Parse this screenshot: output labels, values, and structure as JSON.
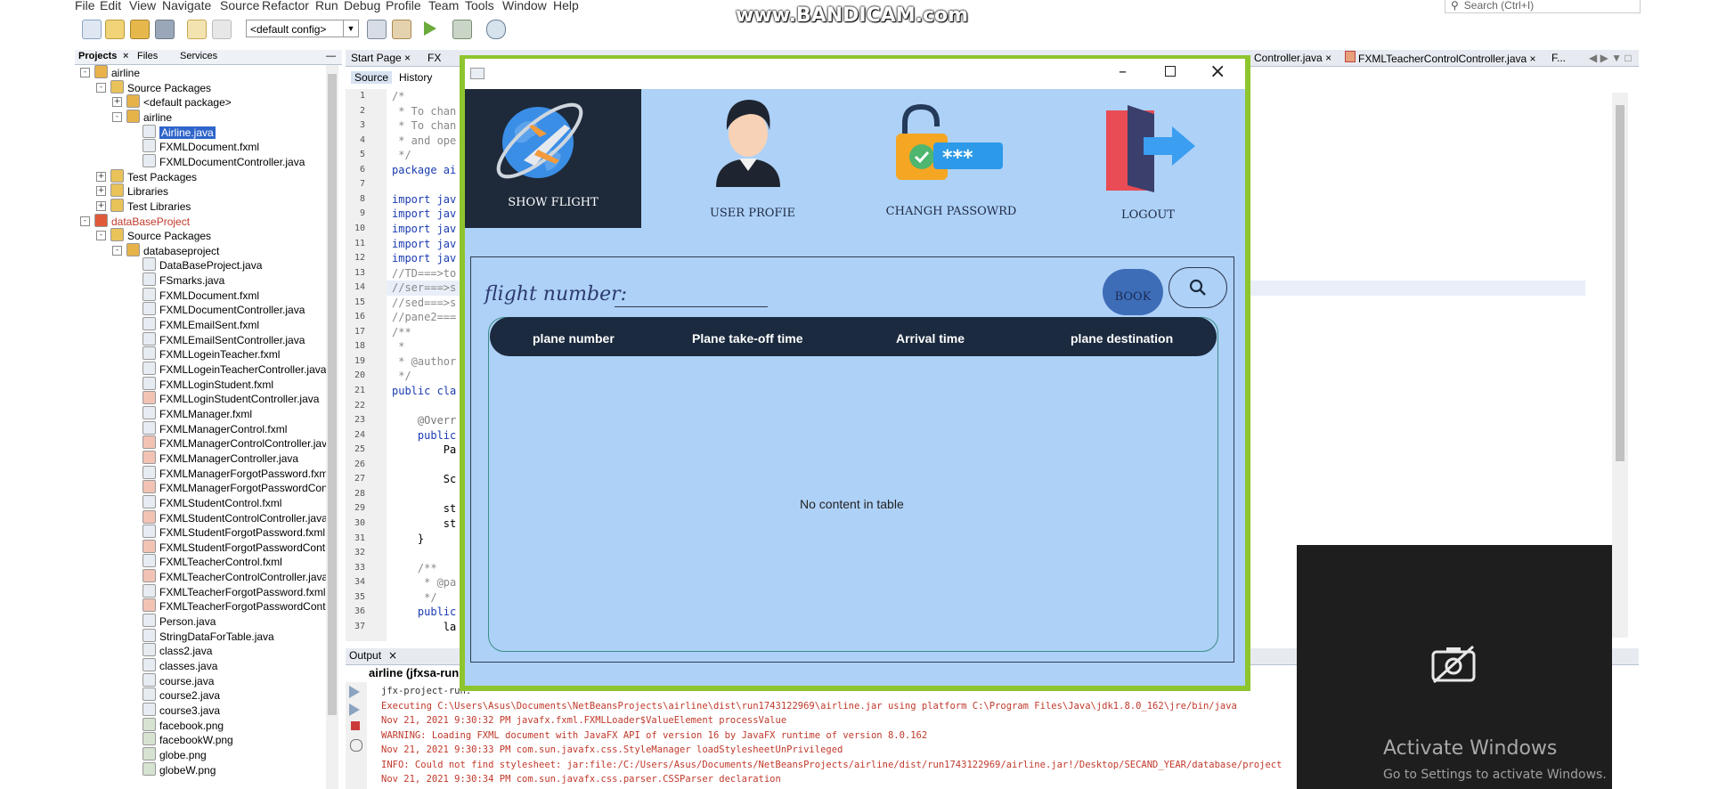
{
  "ide": {
    "menu": [
      "File",
      "Edit",
      "View",
      "Navigate",
      "Source",
      "Refactor",
      "Run",
      "Debug",
      "Profile",
      "Team",
      "Tools",
      "Window",
      "Help"
    ],
    "search_placeholder": "Search (Ctrl+I)",
    "config": "<default config>",
    "panel_tabs": [
      "Projects",
      "Files",
      "Services"
    ],
    "editor_tabs": [
      "Start Page",
      "FX",
      "Controller.java",
      "FXMLTeacherControlController.java",
      "F..."
    ],
    "source_tabs": [
      "Source",
      "History"
    ],
    "tree": [
      {
        "label": "airline",
        "level": 0,
        "toggle": "-",
        "icon": "project-icon",
        "color": "#000"
      },
      {
        "label": "Source Packages",
        "level": 1,
        "toggle": "-",
        "icon": "folder-icon",
        "color": "#000"
      },
      {
        "label": "<default package>",
        "level": 2,
        "toggle": "+",
        "icon": "package-icon",
        "color": "#000"
      },
      {
        "label": "airline",
        "level": 2,
        "toggle": "-",
        "icon": "package-icon",
        "color": "#000"
      },
      {
        "label": "Airline.java",
        "level": 3,
        "toggle": "",
        "icon": "java-file-icon",
        "color": "#fff",
        "selected": true
      },
      {
        "label": "FXMLDocument.fxml",
        "level": 3,
        "toggle": "",
        "icon": "fxml-file-icon",
        "color": "#000"
      },
      {
        "label": "FXMLDocumentController.java",
        "level": 3,
        "toggle": "",
        "icon": "java-file-icon",
        "color": "#000"
      },
      {
        "label": "Test Packages",
        "level": 1,
        "toggle": "+",
        "icon": "folder-icon",
        "color": "#000"
      },
      {
        "label": "Libraries",
        "level": 1,
        "toggle": "+",
        "icon": "folder-icon",
        "color": "#000"
      },
      {
        "label": "Test Libraries",
        "level": 1,
        "toggle": "+",
        "icon": "folder-icon",
        "color": "#000"
      },
      {
        "label": "dataBaseProject",
        "level": 0,
        "toggle": "-",
        "icon": "project-error-icon",
        "color": "#c0392b"
      },
      {
        "label": "Source Packages",
        "level": 1,
        "toggle": "-",
        "icon": "folder-icon",
        "color": "#000"
      },
      {
        "label": "databaseproject",
        "level": 2,
        "toggle": "-",
        "icon": "package-icon",
        "color": "#000"
      },
      {
        "label": "DataBaseProject.java",
        "level": 3,
        "toggle": "",
        "icon": "java-file-icon",
        "color": "#000"
      },
      {
        "label": "FSmarks.java",
        "level": 3,
        "toggle": "",
        "icon": "java-file-icon",
        "color": "#000"
      },
      {
        "label": "FXMLDocument.fxml",
        "level": 3,
        "toggle": "",
        "icon": "fxml-file-icon",
        "color": "#000"
      },
      {
        "label": "FXMLDocumentController.java",
        "level": 3,
        "toggle": "",
        "icon": "java-file-icon",
        "color": "#000"
      },
      {
        "label": "FXMLEmailSent.fxml",
        "level": 3,
        "toggle": "",
        "icon": "fxml-file-icon",
        "color": "#000"
      },
      {
        "label": "FXMLEmailSentController.java",
        "level": 3,
        "toggle": "",
        "icon": "java-file-icon",
        "color": "#000"
      },
      {
        "label": "FXMLLogeinTeacher.fxml",
        "level": 3,
        "toggle": "",
        "icon": "fxml-file-icon",
        "color": "#000"
      },
      {
        "label": "FXMLLogeinTeacherController.java",
        "level": 3,
        "toggle": "",
        "icon": "java-file-icon",
        "color": "#000"
      },
      {
        "label": "FXMLLoginStudent.fxml",
        "level": 3,
        "toggle": "",
        "icon": "fxml-file-icon",
        "color": "#000"
      },
      {
        "label": "FXMLLoginStudentController.java",
        "level": 3,
        "toggle": "",
        "icon": "java-error-icon",
        "color": "#000"
      },
      {
        "label": "FXMLManager.fxml",
        "level": 3,
        "toggle": "",
        "icon": "fxml-file-icon",
        "color": "#000"
      },
      {
        "label": "FXMLManagerControl.fxml",
        "level": 3,
        "toggle": "",
        "icon": "fxml-file-icon",
        "color": "#000"
      },
      {
        "label": "FXMLManagerControlController.java",
        "level": 3,
        "toggle": "",
        "icon": "java-error-icon",
        "color": "#000"
      },
      {
        "label": "FXMLManagerController.java",
        "level": 3,
        "toggle": "",
        "icon": "java-error-icon",
        "color": "#000"
      },
      {
        "label": "FXMLManagerForgotPassword.fxml",
        "level": 3,
        "toggle": "",
        "icon": "fxml-file-icon",
        "color": "#000"
      },
      {
        "label": "FXMLManagerForgotPasswordContr",
        "level": 3,
        "toggle": "",
        "icon": "java-error-icon",
        "color": "#000"
      },
      {
        "label": "FXMLStudentControl.fxml",
        "level": 3,
        "toggle": "",
        "icon": "fxml-file-icon",
        "color": "#000"
      },
      {
        "label": "FXMLStudentControlController.java",
        "level": 3,
        "toggle": "",
        "icon": "java-error-icon",
        "color": "#000"
      },
      {
        "label": "FXMLStudentForgotPassword.fxml",
        "level": 3,
        "toggle": "",
        "icon": "fxml-file-icon",
        "color": "#000"
      },
      {
        "label": "FXMLStudentForgotPasswordContr",
        "level": 3,
        "toggle": "",
        "icon": "java-error-icon",
        "color": "#000"
      },
      {
        "label": "FXMLTeacherControl.fxml",
        "level": 3,
        "toggle": "",
        "icon": "fxml-file-icon",
        "color": "#000"
      },
      {
        "label": "FXMLTeacherControlController.java",
        "level": 3,
        "toggle": "",
        "icon": "java-error-icon",
        "color": "#000"
      },
      {
        "label": "FXMLTeacherForgotPassword.fxml",
        "level": 3,
        "toggle": "",
        "icon": "fxml-file-icon",
        "color": "#000"
      },
      {
        "label": "FXMLTeacherForgotPasswordContr",
        "level": 3,
        "toggle": "",
        "icon": "java-error-icon",
        "color": "#000"
      },
      {
        "label": "Person.java",
        "level": 3,
        "toggle": "",
        "icon": "java-file-icon",
        "color": "#000"
      },
      {
        "label": "StringDataForTable.java",
        "level": 3,
        "toggle": "",
        "icon": "java-file-icon",
        "color": "#000"
      },
      {
        "label": "class2.java",
        "level": 3,
        "toggle": "",
        "icon": "java-file-icon",
        "color": "#000"
      },
      {
        "label": "classes.java",
        "level": 3,
        "toggle": "",
        "icon": "java-file-icon",
        "color": "#000"
      },
      {
        "label": "course.java",
        "level": 3,
        "toggle": "",
        "icon": "java-file-icon",
        "color": "#000"
      },
      {
        "label": "course2.java",
        "level": 3,
        "toggle": "",
        "icon": "java-file-icon",
        "color": "#000"
      },
      {
        "label": "course3.java",
        "level": 3,
        "toggle": "",
        "icon": "java-file-icon",
        "color": "#000"
      },
      {
        "label": "facebook.png",
        "level": 3,
        "toggle": "",
        "icon": "image-file-icon",
        "color": "#000"
      },
      {
        "label": "facebookW.png",
        "level": 3,
        "toggle": "",
        "icon": "image-file-icon",
        "color": "#000"
      },
      {
        "label": "globe.png",
        "level": 3,
        "toggle": "",
        "icon": "image-file-icon",
        "color": "#000"
      },
      {
        "label": "globeW.png",
        "level": 3,
        "toggle": "",
        "icon": "image-file-icon",
        "color": "#000"
      }
    ],
    "line_numbers": [
      "1",
      "2",
      "3",
      "4",
      "5",
      "6",
      "7",
      "8",
      "9",
      "10",
      "11",
      "12",
      "13",
      "14",
      "15",
      "16",
      "17",
      "18",
      "19",
      "20",
      "21",
      "22",
      "23",
      "24",
      "25",
      "26",
      "27",
      "28",
      "29",
      "30",
      "31",
      "32",
      "33",
      "34",
      "35",
      "36",
      "37"
    ],
    "code_lines": [
      {
        "text": "/*",
        "color": "#888"
      },
      {
        "text": " * To chan",
        "color": "#888"
      },
      {
        "text": " * To chan",
        "color": "#888"
      },
      {
        "text": " * and ope",
        "color": "#888"
      },
      {
        "text": " */",
        "color": "#888"
      },
      {
        "text": "package ai",
        "color": "#1a3bb0"
      },
      {
        "text": "",
        "color": "#000"
      },
      {
        "text": "import jav",
        "color": "#1a3bb0"
      },
      {
        "text": "import jav",
        "color": "#1a3bb0"
      },
      {
        "text": "import jav",
        "color": "#1a3bb0"
      },
      {
        "text": "import jav",
        "color": "#1a3bb0"
      },
      {
        "text": "import jav",
        "color": "#1a3bb0"
      },
      {
        "text": "//TD===>to",
        "color": "#888"
      },
      {
        "text": "//ser===>s",
        "color": "#888"
      },
      {
        "text": "//sed===>s",
        "color": "#888"
      },
      {
        "text": "//pane2===",
        "color": "#888"
      },
      {
        "text": "/**",
        "color": "#888"
      },
      {
        "text": " *",
        "color": "#888"
      },
      {
        "text": " * @author",
        "color": "#888"
      },
      {
        "text": " */",
        "color": "#888"
      },
      {
        "text": "public cla",
        "color": "#1a3bb0"
      },
      {
        "text": "",
        "color": "#000"
      },
      {
        "text": "    @Overr",
        "color": "#777"
      },
      {
        "text": "    public",
        "color": "#1a3bb0"
      },
      {
        "text": "        Pa",
        "color": "#000"
      },
      {
        "text": "",
        "color": "#000"
      },
      {
        "text": "        Sc",
        "color": "#000"
      },
      {
        "text": "",
        "color": "#000"
      },
      {
        "text": "        st",
        "color": "#000"
      },
      {
        "text": "        st",
        "color": "#000"
      },
      {
        "text": "    }",
        "color": "#000"
      },
      {
        "text": "",
        "color": "#000"
      },
      {
        "text": "    /**",
        "color": "#888"
      },
      {
        "text": "     * @pa",
        "color": "#888"
      },
      {
        "text": "     */",
        "color": "#888"
      },
      {
        "text": "    public",
        "color": "#1a3bb0"
      },
      {
        "text": "        la",
        "color": "#000"
      }
    ],
    "output": {
      "tab": "Output",
      "title": "airline (jfxsa-run",
      "lines": [
        {
          "text": "jfx-project-run:",
          "color": "#333"
        },
        {
          "text": "Executing C:\\Users\\Asus\\Documents\\NetBeansProjects\\airline\\dist\\run1743122969\\airline.jar using platform C:\\Program Files\\Java\\jdk1.8.0_162\\jre/bin/java",
          "color": "#c0392b"
        },
        {
          "text": "Nov 21, 2021 9:30:32 PM javafx.fxml.FXMLLoader$ValueElement processValue",
          "color": "#c0392b"
        },
        {
          "text": "WARNING: Loading FXML document with JavaFX API of version 16 by JavaFX runtime of version 8.0.162",
          "color": "#c0392b"
        },
        {
          "text": "Nov 21, 2021 9:30:33 PM com.sun.javafx.css.StyleManager loadStylesheetUnPrivileged",
          "color": "#c0392b"
        },
        {
          "text": "INFO: Could not find stylesheet: jar:file:/C:/Users/Asus/Documents/NetBeansProjects/airline/dist/run1743122969/airline.jar!/Desktop/SECAND_YEAR/database/project",
          "color": "#c0392b"
        },
        {
          "text": "Nov 21, 2021 9:30:34 PM com.sun.javafx.css.parser.CSSParser declaration",
          "color": "#c0392b"
        }
      ]
    }
  },
  "app": {
    "nav": [
      {
        "label": "SHOW FLIGHT",
        "icon": "globe-plane-icon"
      },
      {
        "label": "USER PROFIE",
        "icon": "user-avatar-icon"
      },
      {
        "label": "CHANGH PASSOWRD",
        "icon": "padlock-password-icon"
      },
      {
        "label": "LOGOUT",
        "icon": "logout-door-icon"
      }
    ],
    "flight_label": "flight number:",
    "flight_value": "",
    "book_label": "BOOK",
    "search_icon": "search-icon",
    "columns": [
      "plane number",
      "Plane take-off time",
      "Arrival time",
      "plane destination"
    ],
    "empty_message": "No content in table",
    "colors": {
      "frame": "#8ec52e",
      "background": "#aed1f7",
      "header": "#1b2a3e",
      "active_tile": "#1e2a3a"
    }
  },
  "watermark": {
    "bandicam": "www.BANDICAM.com",
    "activate_title": "Activate Windows",
    "activate_sub": "Go to Settings to activate Windows."
  }
}
